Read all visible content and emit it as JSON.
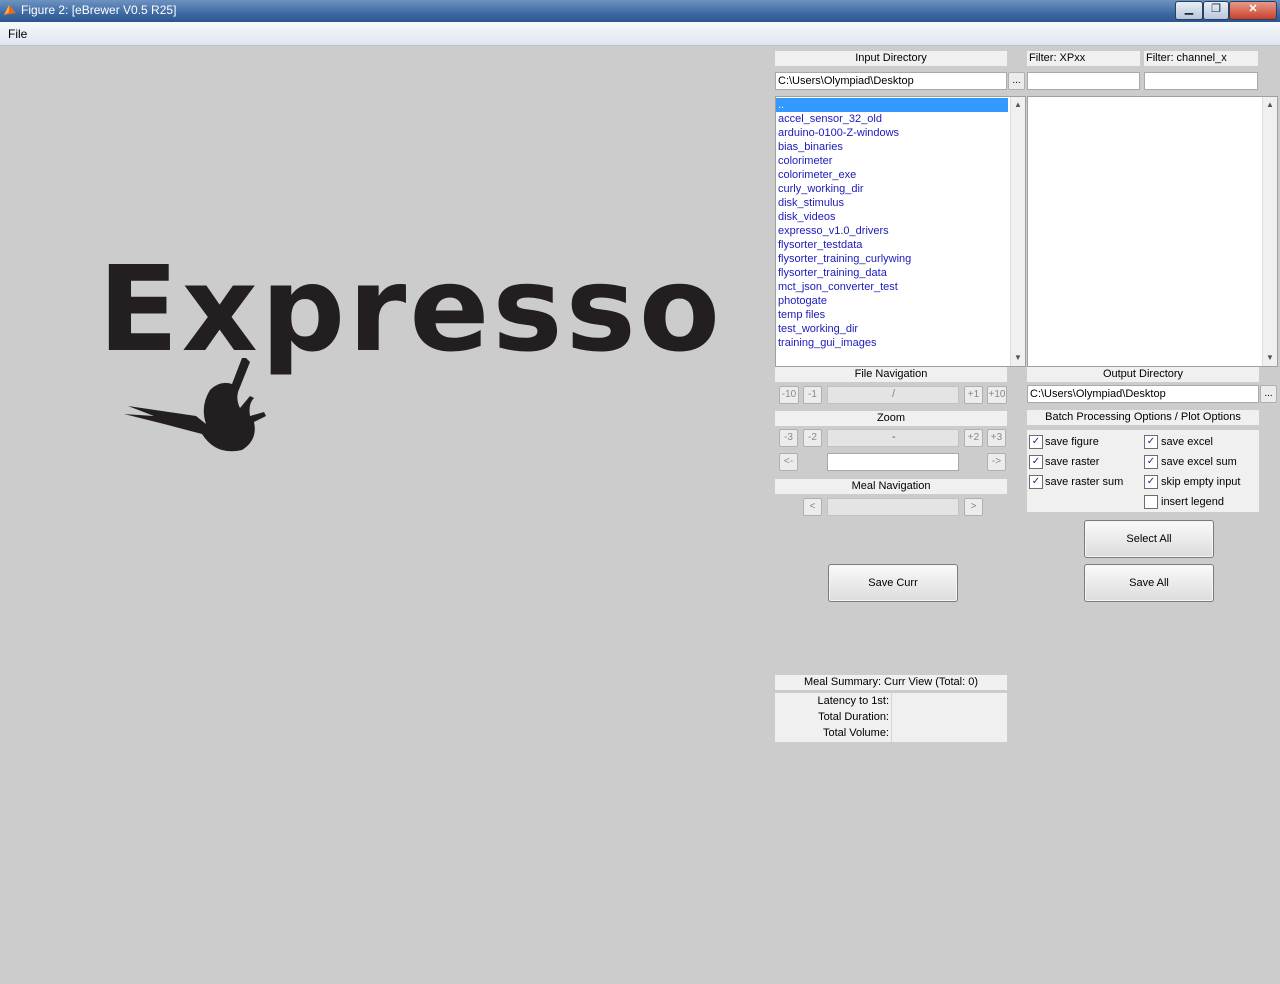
{
  "window": {
    "title": "Figure 2: [eBrewer V0.5 R25]",
    "minimize_glyph": "▁",
    "maximize_glyph": "❐",
    "close_glyph": "✕"
  },
  "menu": {
    "file": "File"
  },
  "logo": {
    "text": "Expresso"
  },
  "input_directory": {
    "header": "Input Directory",
    "value": "C:\\Users\\Olympiad\\Desktop",
    "browse_label": "..."
  },
  "filters": {
    "filter1_label": "Filter:  XPxx",
    "filter1_value": "",
    "filter2_label": "Filter:  channel_x",
    "filter2_value": ""
  },
  "dir_list": {
    "items": [
      "..",
      "accel_sensor_32_old",
      "arduino-0100-Z-windows",
      "bias_binaries",
      "colorimeter",
      "colorimeter_exe",
      "curly_working_dir",
      "disk_stimulus",
      "disk_videos",
      "expresso_v1.0_drivers",
      "flysorter_testdata",
      "flysorter_training_curlywing",
      "flysorter_training_data",
      "mct_json_converter_test",
      "photogate",
      "temp files",
      "test_working_dir",
      "training_gui_images"
    ],
    "scroll_up": "▲",
    "scroll_down": "▼"
  },
  "file_list": {
    "scroll_up": "▲",
    "scroll_down": "▼"
  },
  "file_navigation": {
    "header": "File Navigation",
    "minus10": "-10",
    "minus1": "-1",
    "plus1": "+1",
    "plus10": "+10",
    "value": "/"
  },
  "output_directory": {
    "header": "Output Directory",
    "value": "C:\\Users\\Olympiad\\Desktop",
    "browse_label": "..."
  },
  "zoom": {
    "header": "Zoom",
    "minus3": "-3",
    "minus2": "-2",
    "plus2": "+2",
    "plus3": "+3",
    "value": "-",
    "left": "<-",
    "right": "->",
    "field": ""
  },
  "batch": {
    "header": "Batch Processing Options / Plot Options",
    "options": [
      {
        "label": "save figure",
        "checked": true
      },
      {
        "label": "save excel",
        "checked": true
      },
      {
        "label": "save raster",
        "checked": true
      },
      {
        "label": "save excel sum",
        "checked": true
      },
      {
        "label": "save raster sum",
        "checked": true
      },
      {
        "label": "skip empty input",
        "checked": true
      },
      {
        "label": "insert legend",
        "checked": false
      }
    ],
    "check_glyph": "✓"
  },
  "meal_navigation": {
    "header": "Meal Navigation",
    "prev": "<",
    "next": ">"
  },
  "buttons": {
    "select_all": "Select All",
    "save_curr": "Save Curr",
    "save_all": "Save All"
  },
  "meal_summary": {
    "header": "Meal Summary: Curr View (Total: 0)",
    "latency_label": "Latency to 1st:",
    "duration_label": "Total Duration:",
    "volume_label": "Total Volume:"
  },
  "colors": {
    "background": "#cccccc",
    "list_text": "#1b1bb8",
    "selection": "#3399ff"
  }
}
